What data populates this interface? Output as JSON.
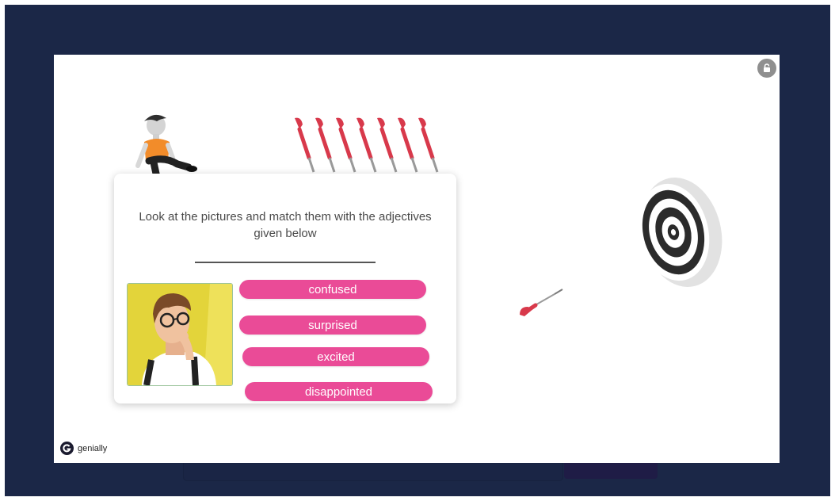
{
  "question": {
    "text": "Look at the pictures and match them with the adjectives given below"
  },
  "options": [
    {
      "label": "confused"
    },
    {
      "label": "surprised"
    },
    {
      "label": "excited"
    },
    {
      "label": "disappointed"
    }
  ],
  "brand": {
    "name": "genially"
  },
  "colors": {
    "frame_background": "#1b2747",
    "slide_background": "#ffffff",
    "pill": "#ea4b97",
    "dart": "#d8394b",
    "photo_background": "#e3d43a"
  },
  "icons": [
    "lock-icon",
    "genially-logo-icon",
    "dart-icon",
    "dartboard-target-icon",
    "boy-figure-illustration"
  ]
}
